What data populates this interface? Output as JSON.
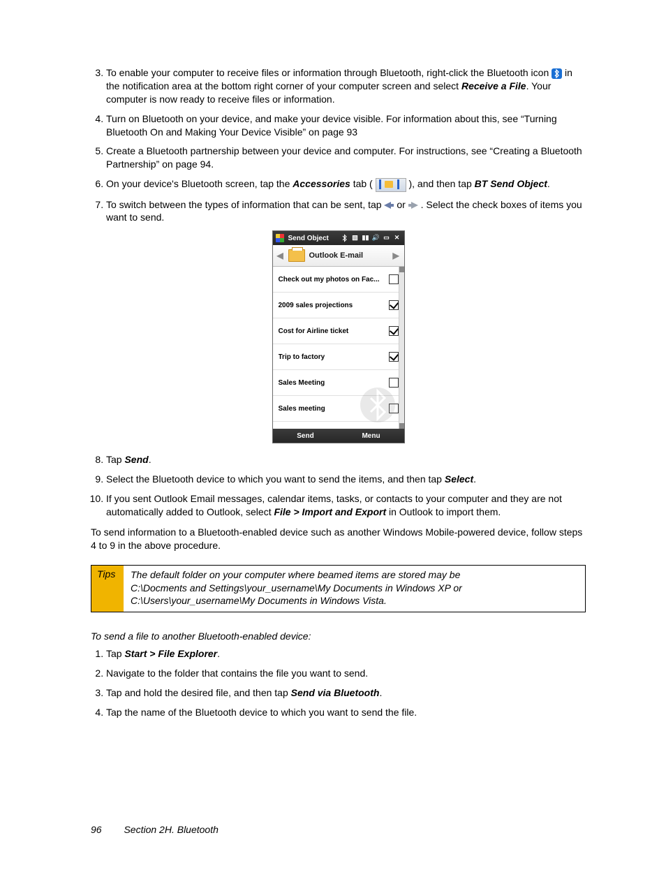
{
  "steps1": {
    "s3a": "To enable your computer to receive files or information through Bluetooth, right-click the Bluetooth icon ",
    "s3b": " in the notification area at the bottom right corner of your computer screen and select ",
    "s3c": "Receive a File",
    "s3d": ". Your computer is now ready to receive files or information.",
    "s4": "Turn on Bluetooth on your device, and make your device visible. For information about this, see “Turning Bluetooth On and Making Your Device Visible” on page 93",
    "s5": "Create a Bluetooth partnership between your device and computer. For instructions, see “Creating a Bluetooth Partnership” on page 94.",
    "s6a": "On your device's Bluetooth screen, tap the ",
    "s6b": "Accessories",
    "s6c": " tab ( ",
    "s6d": " ), and then tap ",
    "s6e": "BT Send Object",
    "s6f": ".",
    "s7a": "To switch between the types of information that can be sent, tap ",
    "s7b": " or ",
    "s7c": ". Select the check boxes of items you want to send."
  },
  "screenshot": {
    "title": "Send Object",
    "category": "Outlook E-mail",
    "items": [
      {
        "label": "Check out my photos on Fac...",
        "checked": false
      },
      {
        "label": "2009 sales projections",
        "checked": true
      },
      {
        "label": "Cost for Airline ticket",
        "checked": true
      },
      {
        "label": "Trip to factory",
        "checked": true
      },
      {
        "label": "Sales Meeting",
        "checked": false
      },
      {
        "label": "Sales meeting",
        "checked": false
      }
    ],
    "footer_left": "Send",
    "footer_right": "Menu"
  },
  "steps2": {
    "s8a": "Tap ",
    "s8b": "Send",
    "s8c": ".",
    "s9a": "Select the Bluetooth device to which you want to send the items, and then tap ",
    "s9b": "Select",
    "s9c": ".",
    "s10a": "If you sent Outlook Email messages, calendar items, tasks, or contacts to your computer and they are not automatically added to Outlook, select ",
    "s10b": "File > Import and Export",
    "s10c": " in Outlook to import them."
  },
  "para_after": "To send information to a Bluetooth-enabled device such as another Windows Mobile-powered device, follow steps 4 to 9 in the above procedure.",
  "tips": {
    "label": "Tips",
    "line1": "The default folder on your computer where beamed items are stored may be",
    "line2": "C:\\Docments and Settings\\your_username\\My Documents in Windows XP or",
    "line3": "C:\\Users\\your_username\\My Documents in Windows Vista."
  },
  "subheading": "To send a file to another Bluetooth-enabled device:",
  "steps3": {
    "s1a": "Tap ",
    "s1b": "Start > File Explorer",
    "s1c": ".",
    "s2": "Navigate to the folder that contains the file you want to send.",
    "s3a": "Tap and hold the desired file, and then tap ",
    "s3b": "Send via Bluetooth",
    "s3c": ".",
    "s4": "Tap the name of the Bluetooth device to which you want to send the file."
  },
  "footer": {
    "page": "96",
    "section": "Section 2H. Bluetooth"
  }
}
